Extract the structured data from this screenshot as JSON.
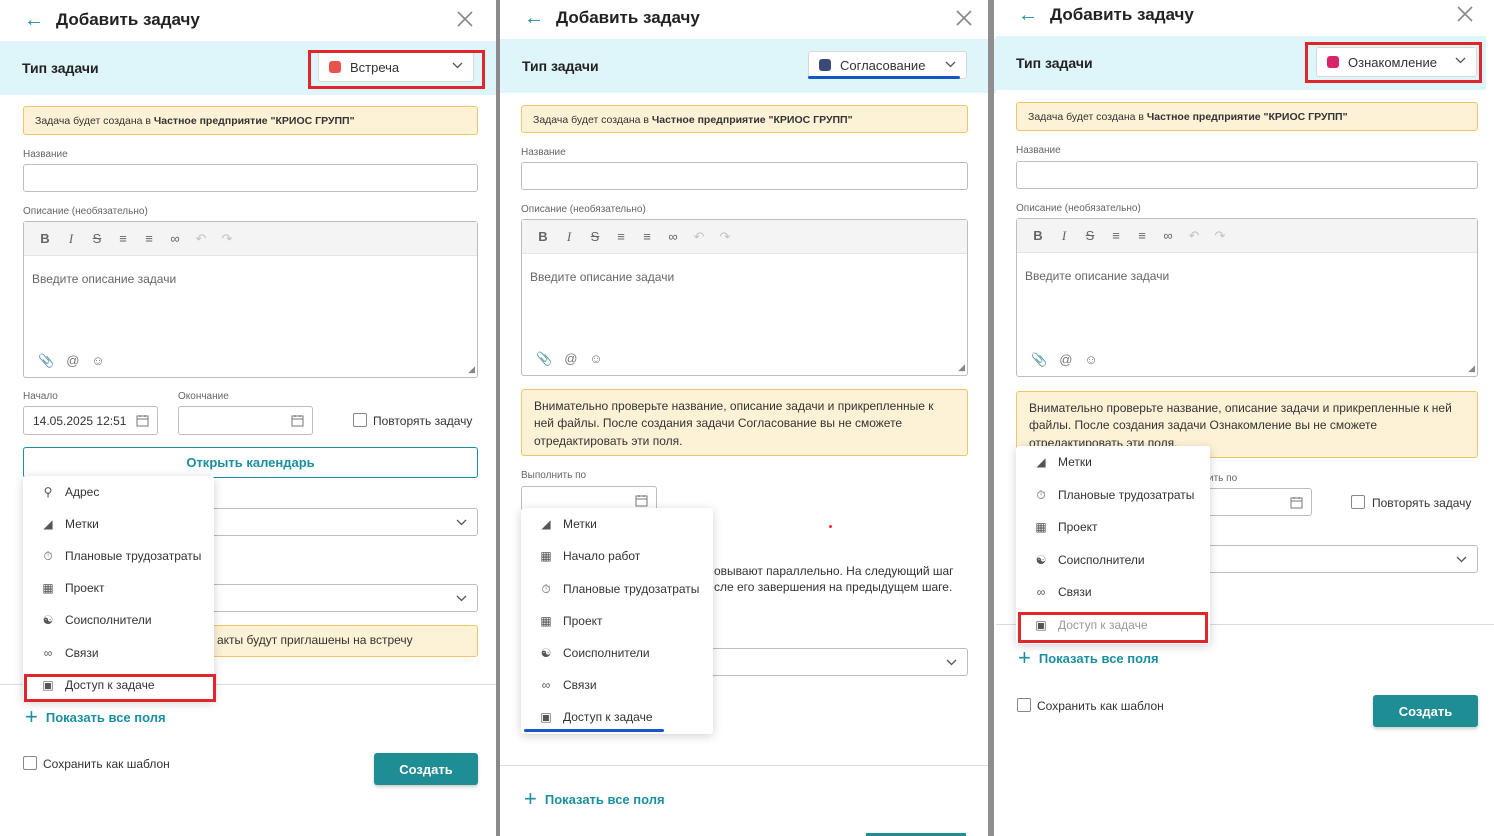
{
  "colors": {
    "accent": "#1a8fa0",
    "type_bar": "#def5fa",
    "warning_bg": "#fdf2d6",
    "highlight_red": "#e0252b",
    "highlight_blue": "#1656c8",
    "meeting": "#e8534e",
    "approval": "#3b4a78",
    "review": "#d8246a"
  },
  "panels": [
    {
      "title": "Добавить задачу",
      "type_label": "Тип задачи",
      "type_value": "Встреча",
      "info_prefix": "Задача будет создана в",
      "info_org": "Частное предприятие \"КРИОС ГРУПП\"",
      "name_label": "Название",
      "desc_label": "Описание (необязательно)",
      "desc_placeholder": "Введите описание задачи",
      "start_label": "Начало",
      "start_value": "14.05.2025 12:51",
      "end_label": "Окончание",
      "repeat_label": "Повторять задачу",
      "open_calendar": "Открыть календарь",
      "invite_partial": "акты будут приглашены на встречу",
      "menu": [
        "Адрес",
        "Метки",
        "Плановые трудозатраты",
        "Проект",
        "Соисполнители",
        "Связи",
        "Доступ к задаче"
      ],
      "show_all": "Показать все поля",
      "save_template": "Сохранить как шаблон",
      "create": "Создать"
    },
    {
      "title": "Добавить задачу",
      "type_label": "Тип задачи",
      "type_value": "Согласование",
      "info_prefix": "Задача будет создана в",
      "info_org": "Частное предприятие \"КРИОС ГРУПП\"",
      "name_label": "Название",
      "desc_label": "Описание (необязательно)",
      "desc_placeholder": "Введите описание задачи",
      "warning": "Внимательно проверьте название, описание задачи и прикрепленные к ней файлы. После создания задачи Согласование вы не сможете отредактировать эти поля.",
      "due_label": "Выполнить по",
      "parallel_line1": "овывают параллельно. На следующий шаг",
      "parallel_line2": "сле его завершения на предыдущем шаге.",
      "menu": [
        "Метки",
        "Начало работ",
        "Плановые трудозатраты",
        "Проект",
        "Соисполнители",
        "Связи",
        "Доступ к задаче"
      ],
      "show_all": "Показать все поля"
    },
    {
      "title": "Добавить задачу",
      "type_label": "Тип задачи",
      "type_value": "Ознакомление",
      "info_prefix": "Задача будет создана в",
      "info_org": "Частное предприятие \"КРИОС ГРУПП\"",
      "name_label": "Название",
      "desc_label": "Описание (необязательно)",
      "desc_placeholder": "Введите описание задачи",
      "warning": "Внимательно проверьте название, описание задачи и прикрепленные к ней файлы. После создания задачи Ознакомление вы не сможете отредактировать эти поля.",
      "due_label_partial": "ить по",
      "repeat_label": "Повторять задачу",
      "menu": [
        "Метки",
        "Плановые трудозатраты",
        "Проект",
        "Соисполнители",
        "Связи",
        "Доступ к задаче"
      ],
      "show_all": "Показать все поля",
      "save_template": "Сохранить как шаблон",
      "create": "Создать"
    }
  ]
}
